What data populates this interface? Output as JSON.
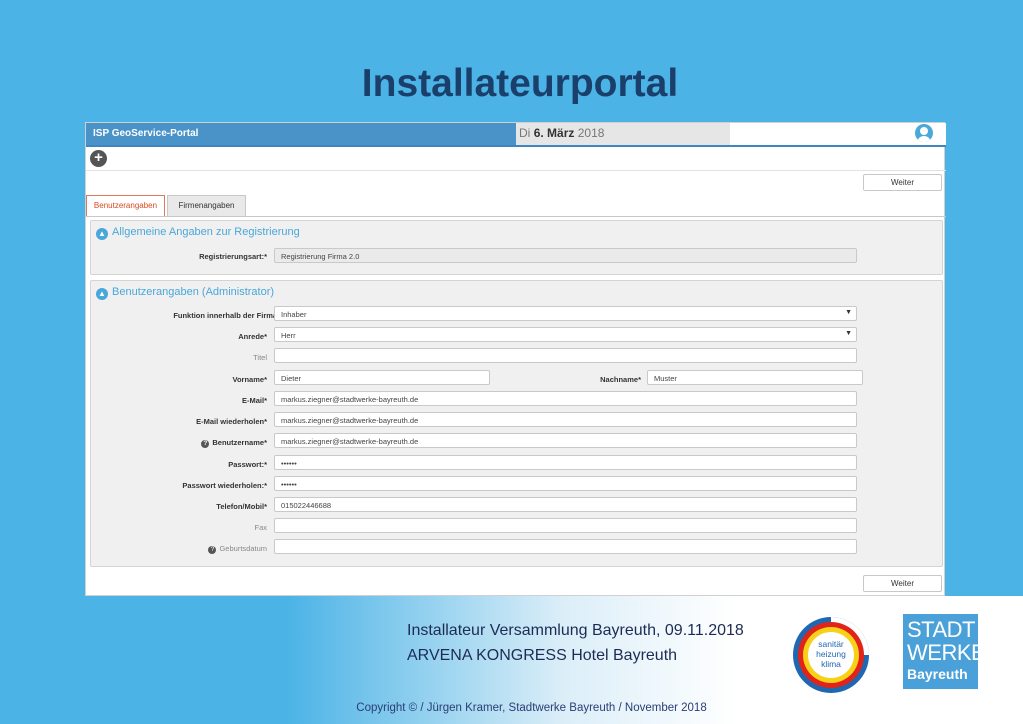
{
  "slide": {
    "title": "Installateurportal",
    "footer_line1": "Installateur Versammlung Bayreuth, 09.11.2018",
    "footer_line2": "ARVENA KONGRESS Hotel Bayreuth",
    "copyright": "Copyright © / Jürgen Kramer, Stadtwerke Bayreuth / November 2018"
  },
  "app": {
    "name": "ISP GeoService-Portal",
    "date_prefix": "Di",
    "date_bold": "6. März",
    "date_year": "2018",
    "add_symbol": "+"
  },
  "buttons": {
    "next_top": "Weiter",
    "next_bottom": "Weiter"
  },
  "tabs": [
    {
      "label": "Benutzerangaben",
      "active": true
    },
    {
      "label": "Firmenangaben",
      "active": false
    }
  ],
  "section_registration": {
    "title": "Allgemeine Angaben zur Registrierung",
    "fields": [
      {
        "label": "Registrierungsart:*",
        "value": "Registrierung Firma 2.0"
      }
    ]
  },
  "section_user": {
    "title": "Benutzerangaben (Administrator)",
    "fields": [
      {
        "label": "Funktion innerhalb der Firma*",
        "value": "Inhaber"
      },
      {
        "label": "Anrede*",
        "value": "Herr"
      },
      {
        "label": "Titel",
        "value": ""
      },
      {
        "label": "Vorname*",
        "value": "Dieter"
      },
      {
        "label": "Nachname*",
        "value": "Muster"
      },
      {
        "label": "E-Mail*",
        "value": "markus.ziegner@stadtwerke-bayreuth.de"
      },
      {
        "label": "E-Mail wiederholen*",
        "value": "markus.ziegner@stadtwerke-bayreuth.de"
      },
      {
        "label": "Benutzername*",
        "value": "markus.ziegner@stadtwerke-bayreuth.de"
      },
      {
        "label": "Passwort:*",
        "value": "••••••"
      },
      {
        "label": "Passwort wiederholen:*",
        "value": "••••••"
      },
      {
        "label": "Telefon/Mobil*",
        "value": "015022446688"
      },
      {
        "label": "Fax",
        "value": ""
      },
      {
        "label": "Geburtsdatum",
        "value": ""
      }
    ]
  },
  "logos": {
    "shk": {
      "line1": "sanitär",
      "line2": "heizung",
      "line3": "klima"
    },
    "swb": {
      "line1": "STADT",
      "line2": "WERKE",
      "line3": "Bayreuth"
    }
  },
  "icons": [
    "user-icon",
    "plus-icon",
    "chevron-up-icon",
    "caret-down-icon",
    "help-icon"
  ],
  "colors": {
    "accent": "#4aa7d9",
    "header": "#4a93c9",
    "tab_active": "#d84a22",
    "slide_bg": "#4bb3e6"
  }
}
